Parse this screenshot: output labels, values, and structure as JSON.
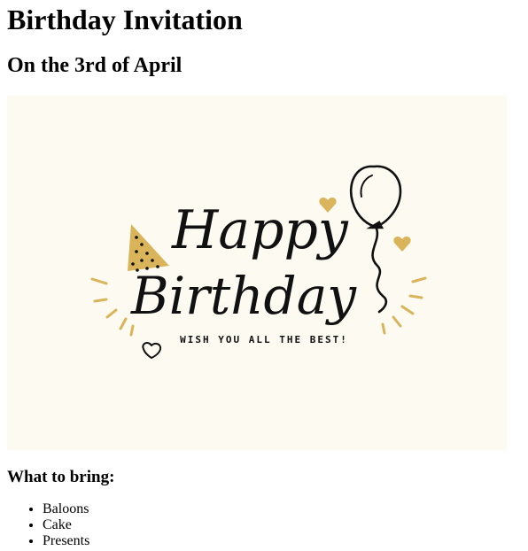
{
  "heading": "Birthday Invitation",
  "subheading": "On the 3rd of April",
  "card": {
    "line1": "Happy",
    "line2": "Birthday",
    "tagline": "WISH YOU ALL THE BEST!",
    "colors": {
      "background": "#fdfaf2",
      "accent": "#d9b45a",
      "ink": "#111111"
    }
  },
  "bring": {
    "title": "What to bring:",
    "items": [
      "Baloons",
      "Cake",
      "Presents"
    ]
  }
}
